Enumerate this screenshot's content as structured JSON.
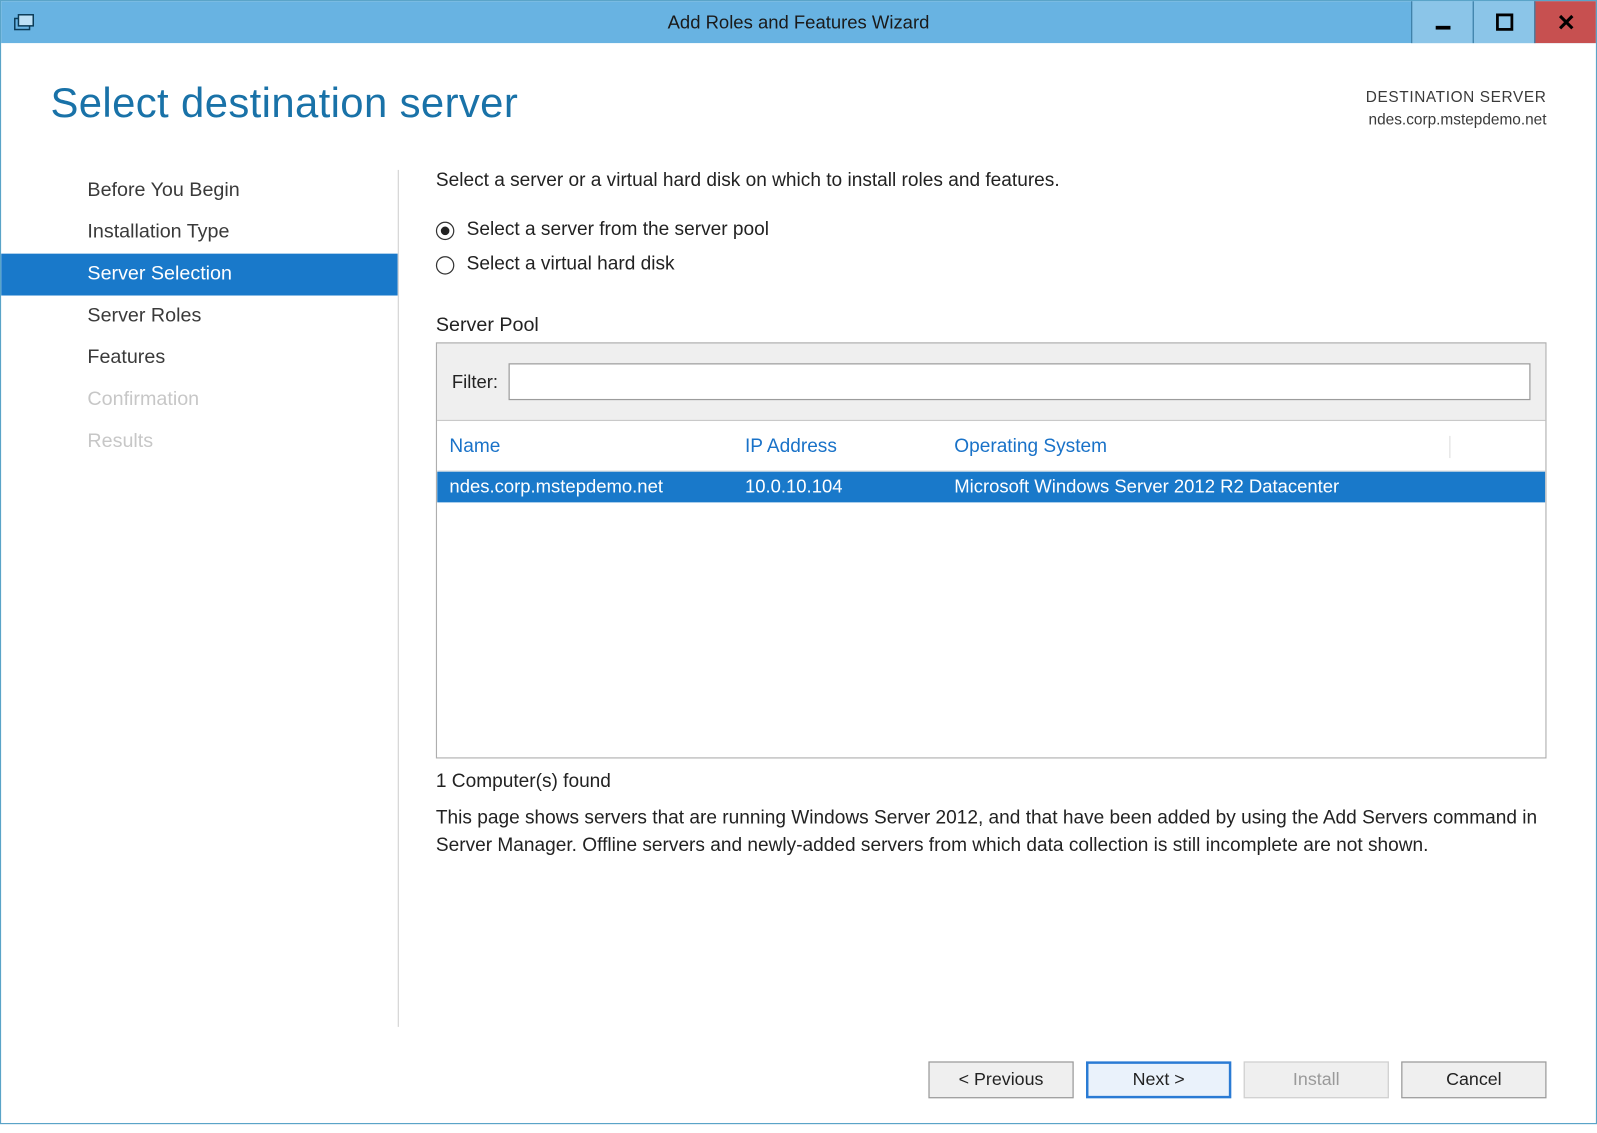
{
  "window": {
    "title": "Add Roles and Features Wizard"
  },
  "header": {
    "page_title": "Select destination server",
    "dest_label": "DESTINATION SERVER",
    "dest_value": "ndes.corp.mstepdemo.net"
  },
  "nav": {
    "items": [
      {
        "label": "Before You Begin",
        "state": "normal"
      },
      {
        "label": "Installation Type",
        "state": "normal"
      },
      {
        "label": "Server Selection",
        "state": "selected"
      },
      {
        "label": "Server Roles",
        "state": "normal"
      },
      {
        "label": "Features",
        "state": "normal"
      },
      {
        "label": "Confirmation",
        "state": "disabled"
      },
      {
        "label": "Results",
        "state": "disabled"
      }
    ]
  },
  "main": {
    "instruction": "Select a server or a virtual hard disk on which to install roles and features.",
    "radio1": "Select a server from the server pool",
    "radio2": "Select a virtual hard disk",
    "radio_selected": 0,
    "pool_label": "Server Pool",
    "filter_label": "Filter:",
    "filter_value": "",
    "columns": {
      "name": "Name",
      "ip": "IP Address",
      "os": "Operating System"
    },
    "rows": [
      {
        "name": "ndes.corp.mstepdemo.net",
        "ip": "10.0.10.104",
        "os": "Microsoft Windows Server 2012 R2 Datacenter",
        "selected": true
      }
    ],
    "found_label": "1 Computer(s) found",
    "help_text": "This page shows servers that are running Windows Server 2012, and that have been added by using the Add Servers command in Server Manager. Offline servers and newly-added servers from which data collection is still incomplete are not shown."
  },
  "footer": {
    "previous": "< Previous",
    "next": "Next >",
    "install": "Install",
    "cancel": "Cancel"
  }
}
